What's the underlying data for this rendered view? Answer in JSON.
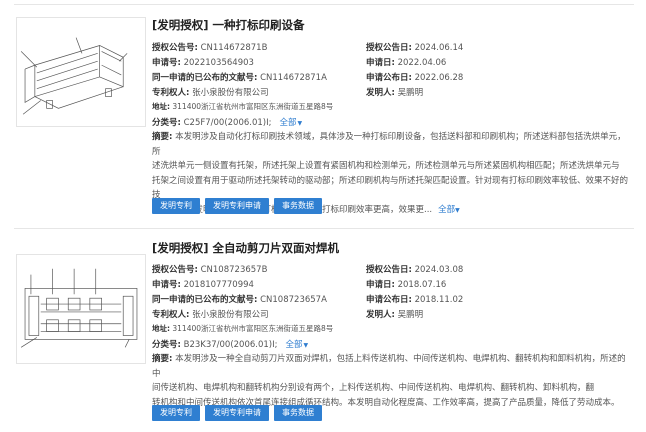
{
  "records": [
    {
      "title": "[发明授权] 一种打标印刷设备",
      "grant_pub_no_label": "授权公告号:",
      "grant_pub_no": "CN114672871B",
      "grant_date_label": "授权公告日:",
      "grant_date": "2024.06.14",
      "app_no_label": "申请号:",
      "app_no": "2022103564903",
      "app_date_label": "申请日:",
      "app_date": "2022.04.06",
      "same_app_label": "同一申请的已公布的文献号:",
      "same_app": "CN114672871A",
      "pub_date_label": "申请公布日:",
      "pub_date": "2022.06.28",
      "patentee_label": "专利权人:",
      "patentee": "张小泉股份有限公司",
      "inventor_label": "发明人:",
      "inventor": "吴鹏明",
      "address_label": "地址:",
      "address": "311400浙江省杭州市富阳区东洲街道五星路8号",
      "classification_label": "分类号:",
      "classification": "C25F7/00(2006.01)I;",
      "expand_label": "全部",
      "abstract_label": "摘要:",
      "abstract_lines": [
        "本发明涉及自动化打标印刷技术领域，具体涉及一种打标印刷设备，包括送料部和印刷机构；所述送料部包括洗烘单元，所",
        "述洗烘单元一侧设置有托架，所述托架上设置有紧固机构和检测单元，所述检测单元与所述紧固机构相匹配；所述洗烘单元与",
        "托架之间设置有用于驱动所述托架转动的驱动部；所述印刷机构与所述托架匹配设置。针对现有打标印刷效率较低、效果不好的技",
        "术问题，本发明可实现自动化打标印刷，使得打标印刷效率更高，效果更..."
      ],
      "more_label": "全部",
      "buttons": [
        "发明专利",
        "发明专利申请",
        "事务数据"
      ]
    },
    {
      "title": "[发明授权] 全自动剪刀片双面对焊机",
      "grant_pub_no_label": "授权公告号:",
      "grant_pub_no": "CN108723657B",
      "grant_date_label": "授权公告日:",
      "grant_date": "2024.03.08",
      "app_no_label": "申请号:",
      "app_no": "2018107770994",
      "app_date_label": "申请日:",
      "app_date": "2018.07.16",
      "same_app_label": "同一申请的已公布的文献号:",
      "same_app": "CN108723657A",
      "pub_date_label": "申请公布日:",
      "pub_date": "2018.11.02",
      "patentee_label": "专利权人:",
      "patentee": "张小泉股份有限公司",
      "inventor_label": "发明人:",
      "inventor": "吴鹏明",
      "address_label": "地址:",
      "address": "311400浙江省杭州市富阳区东洲街道五星路8号",
      "classification_label": "分类号:",
      "classification": "B23K37/00(2006.01)I;",
      "expand_label": "全部",
      "abstract_label": "摘要:",
      "abstract_lines": [
        "本发明涉及一种全自动剪刀片双面对焊机，包括上料传送机构、中间传送机构、电焊机构、翻转机构和卸料机构，所述的中",
        "间传送机构、电焊机构和翻转机构分别设有两个，上料传送机构、中间传送机构、电焊机构、翻转机构、卸料机构，翻",
        "转机构和中间传送机构依次首尾连接组成循环结构。本发明自动化程度高、工作效率高，提高了产品质量，降低了劳动成本。"
      ],
      "more_label": "",
      "buttons": [
        "发明专利",
        "发明专利申请",
        "事务数据"
      ]
    }
  ]
}
